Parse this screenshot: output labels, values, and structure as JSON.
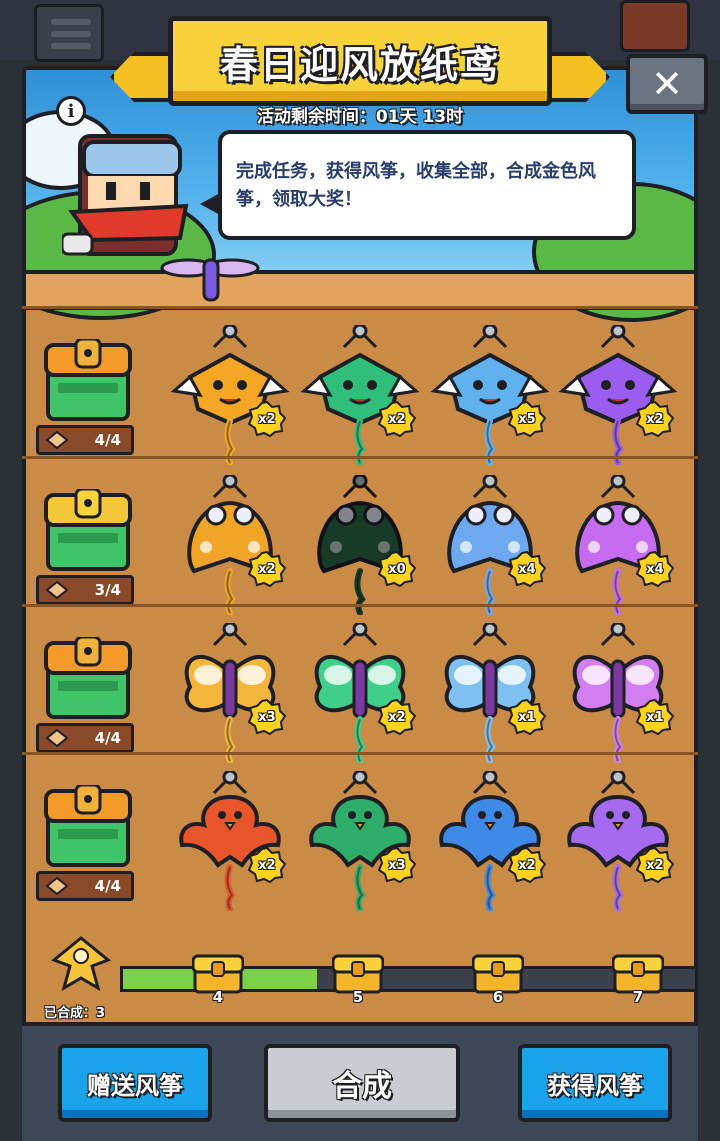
{
  "header": {
    "title": "春日迎风放纸鸢",
    "timer_label": "活动剩余时间：01天 13时",
    "description": "完成任务，获得风筝，收集全部，合成金色风筝，领取大奖！",
    "close_label": "✕",
    "info_label": "i"
  },
  "rows": [
    {
      "progress": "4/4",
      "chest_color": "orange",
      "kites": [
        {
          "color": "#f5a623",
          "count": "x2"
        },
        {
          "color": "#2fbf7a",
          "count": "x2"
        },
        {
          "color": "#5fb2ee",
          "count": "x5"
        },
        {
          "color": "#9b5cf0",
          "count": "x2"
        }
      ]
    },
    {
      "progress": "3/4",
      "chest_color": "gold",
      "kites": [
        {
          "color": "#f0a428",
          "count": "x2"
        },
        {
          "color": "#2a6a4a",
          "count": "x0"
        },
        {
          "color": "#6ea8f0",
          "count": "x4"
        },
        {
          "color": "#c56cf0",
          "count": "x4"
        }
      ]
    },
    {
      "progress": "4/4",
      "chest_color": "orange",
      "kites": [
        {
          "color": "#f5b63c",
          "count": "x3"
        },
        {
          "color": "#3fcf8a",
          "count": "x2"
        },
        {
          "color": "#7ec0f2",
          "count": "x1"
        },
        {
          "color": "#d27ef0",
          "count": "x1"
        }
      ]
    },
    {
      "progress": "4/4",
      "chest_color": "orange",
      "kites": [
        {
          "color": "#e8552a",
          "count": "x2"
        },
        {
          "color": "#2fae6a",
          "count": "x3"
        },
        {
          "color": "#3f8ae6",
          "count": "x2"
        },
        {
          "color": "#a46af0",
          "count": "x2"
        }
      ]
    }
  ],
  "merge": {
    "label": "已合成：3",
    "progress_fraction": 0.34,
    "milestones": [
      "4",
      "5",
      "6",
      "7"
    ]
  },
  "buttons": {
    "gift": "赠送风筝",
    "combine": "合成",
    "obtain": "获得风筝"
  },
  "colors": {
    "banner": "#f8d23a",
    "panel": "#c98b45",
    "button_blue": "#1aa3ea",
    "badge_gold": "#ffd21f"
  }
}
